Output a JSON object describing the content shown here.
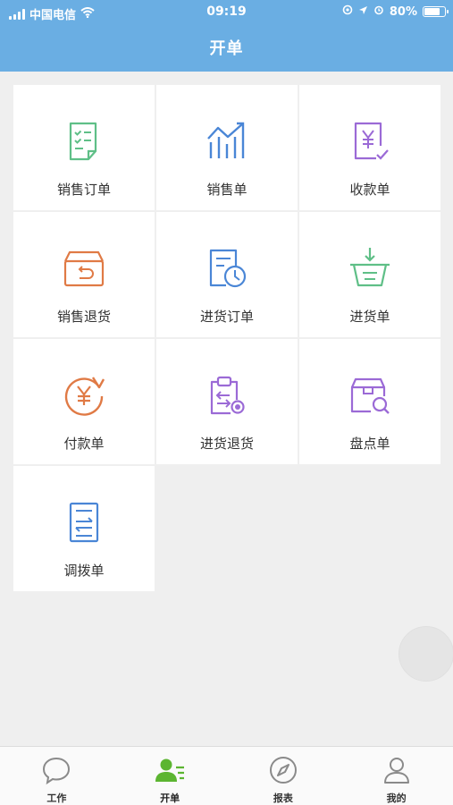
{
  "status_bar": {
    "carrier": "中国电信",
    "time": "09:19",
    "battery_text": "80%",
    "battery_level": 0.8
  },
  "header": {
    "title": "开单"
  },
  "tiles": [
    {
      "label": "销售订单",
      "icon": "checklist-document-icon",
      "color": "#5fbf87"
    },
    {
      "label": "销售单",
      "icon": "trend-chart-icon",
      "color": "#4a86d6"
    },
    {
      "label": "收款单",
      "icon": "yen-receipt-icon",
      "color": "#9b6ad6"
    },
    {
      "label": "销售退货",
      "icon": "return-box-icon",
      "color": "#e07a45"
    },
    {
      "label": "进货订单",
      "icon": "document-clock-icon",
      "color": "#4a86d6"
    },
    {
      "label": "进货单",
      "icon": "basket-download-icon",
      "color": "#5fbf87"
    },
    {
      "label": "付款单",
      "icon": "yen-refresh-icon",
      "color": "#e07a45"
    },
    {
      "label": "进货退货",
      "icon": "clipboard-return-icon",
      "color": "#9b6ad6"
    },
    {
      "label": "盘点单",
      "icon": "box-search-icon",
      "color": "#9b6ad6"
    },
    {
      "label": "调拨单",
      "icon": "transfer-document-icon",
      "color": "#4a86d6"
    }
  ],
  "tabbar": {
    "items": [
      {
        "label": "工作",
        "icon": "chat-bubble-icon",
        "active": false
      },
      {
        "label": "开单",
        "icon": "user-list-icon",
        "active": true
      },
      {
        "label": "报表",
        "icon": "compass-icon",
        "active": false
      },
      {
        "label": "我的",
        "icon": "person-icon",
        "active": false
      }
    ],
    "active_color": "#5cb531",
    "inactive_color": "#8a8a8a"
  }
}
